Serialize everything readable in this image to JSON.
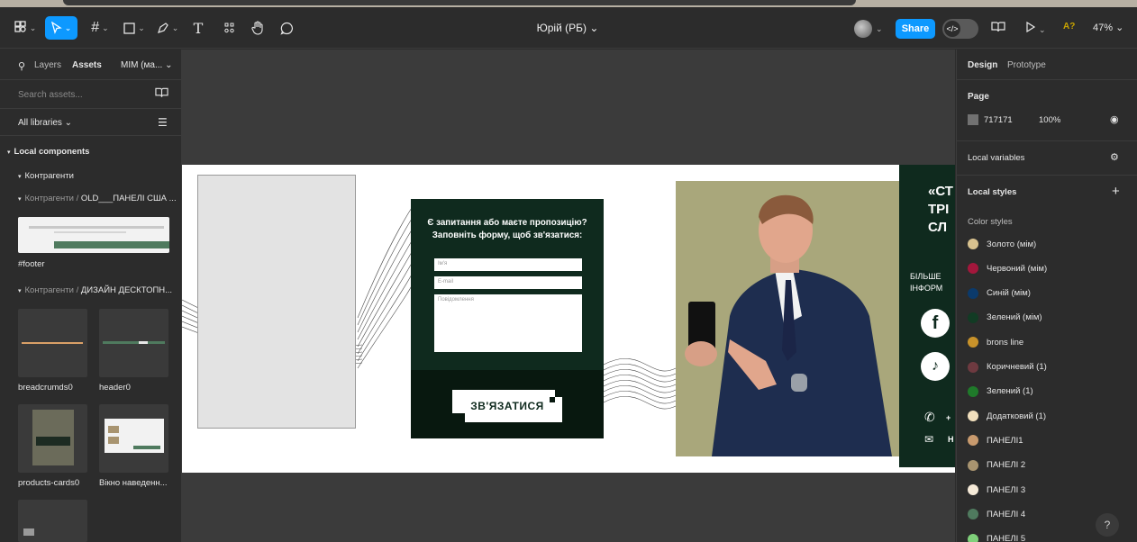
{
  "toolbar": {
    "file_name": "Юрій (РБ) ⌄",
    "share_label": "Share",
    "dev_icon": "</>",
    "zoom": "47% ⌄",
    "a_badge": "A?"
  },
  "left_panel": {
    "tab_layers": "Layers",
    "tab_assets": "Assets",
    "library_name": "MIM (ма... ⌄",
    "search_placeholder": "Search assets...",
    "libraries_label": "All libraries ⌄",
    "section_local": "Local components",
    "group_1": "Контрагенти",
    "group_2_prefix": "Контрагенти / ",
    "group_2_name": "OLD___ПАНЕЛІ США ...",
    "footer_label": "#footer",
    "group_3_prefix": "Контрагенти / ",
    "group_3_name": "ДИЗАЙН ДЕСКТОПН...",
    "components": [
      {
        "label": "breadcrumds0"
      },
      {
        "label": "header0"
      },
      {
        "label": "products-cards0"
      },
      {
        "label": "Вікно наведенн..."
      }
    ]
  },
  "canvas": {
    "form_title": "Є запитання або маєте пропозицію? Заповніть форму, щоб зв'язатися:",
    "field_name": "Ім'я",
    "field_email": "E-mail",
    "field_message": "Повідомлення",
    "cta": "ЗВ'ЯЗАТИСЯ",
    "right_title": "«СТ ТРІ СЛ",
    "right_sub": "БІЛЬШЕ ІНФОРМ",
    "phone_partial": "+",
    "mail_partial": "Н"
  },
  "right_panel": {
    "tab_design": "Design",
    "tab_prototype": "Prototype",
    "page_label": "Page",
    "page_color": "717171",
    "page_opacity": "100%",
    "local_variables": "Local variables",
    "local_styles": "Local styles",
    "color_styles": "Color styles",
    "swatches": [
      {
        "name": "Золото (мім)",
        "color": "#d8c28f"
      },
      {
        "name": "Червоний (мім)",
        "color": "#a3173c"
      },
      {
        "name": "Синій (мім)",
        "color": "#0b3a6b"
      },
      {
        "name": "Зелений (мім)",
        "color": "#123b24"
      },
      {
        "name": "brons line",
        "color": "#c8922a"
      },
      {
        "name": "Коричневий (1)",
        "color": "#6e3a40"
      },
      {
        "name": "Зелений (1)",
        "color": "#1f7a2a"
      },
      {
        "name": "Додатковий (1)",
        "color": "#f1dfbd"
      },
      {
        "name": "ПАНЕЛІ1",
        "color": "#c89a6e"
      },
      {
        "name": "ПАНЕЛІ 2",
        "color": "#a89470"
      },
      {
        "name": "ПАНЕЛІ 3",
        "color": "#f5ead8"
      },
      {
        "name": "ПАНЕЛІ 4",
        "color": "#4f7a5e"
      },
      {
        "name": "ПАНЕЛІ 5",
        "color": "#7fd07a"
      }
    ]
  },
  "help_label": "?"
}
